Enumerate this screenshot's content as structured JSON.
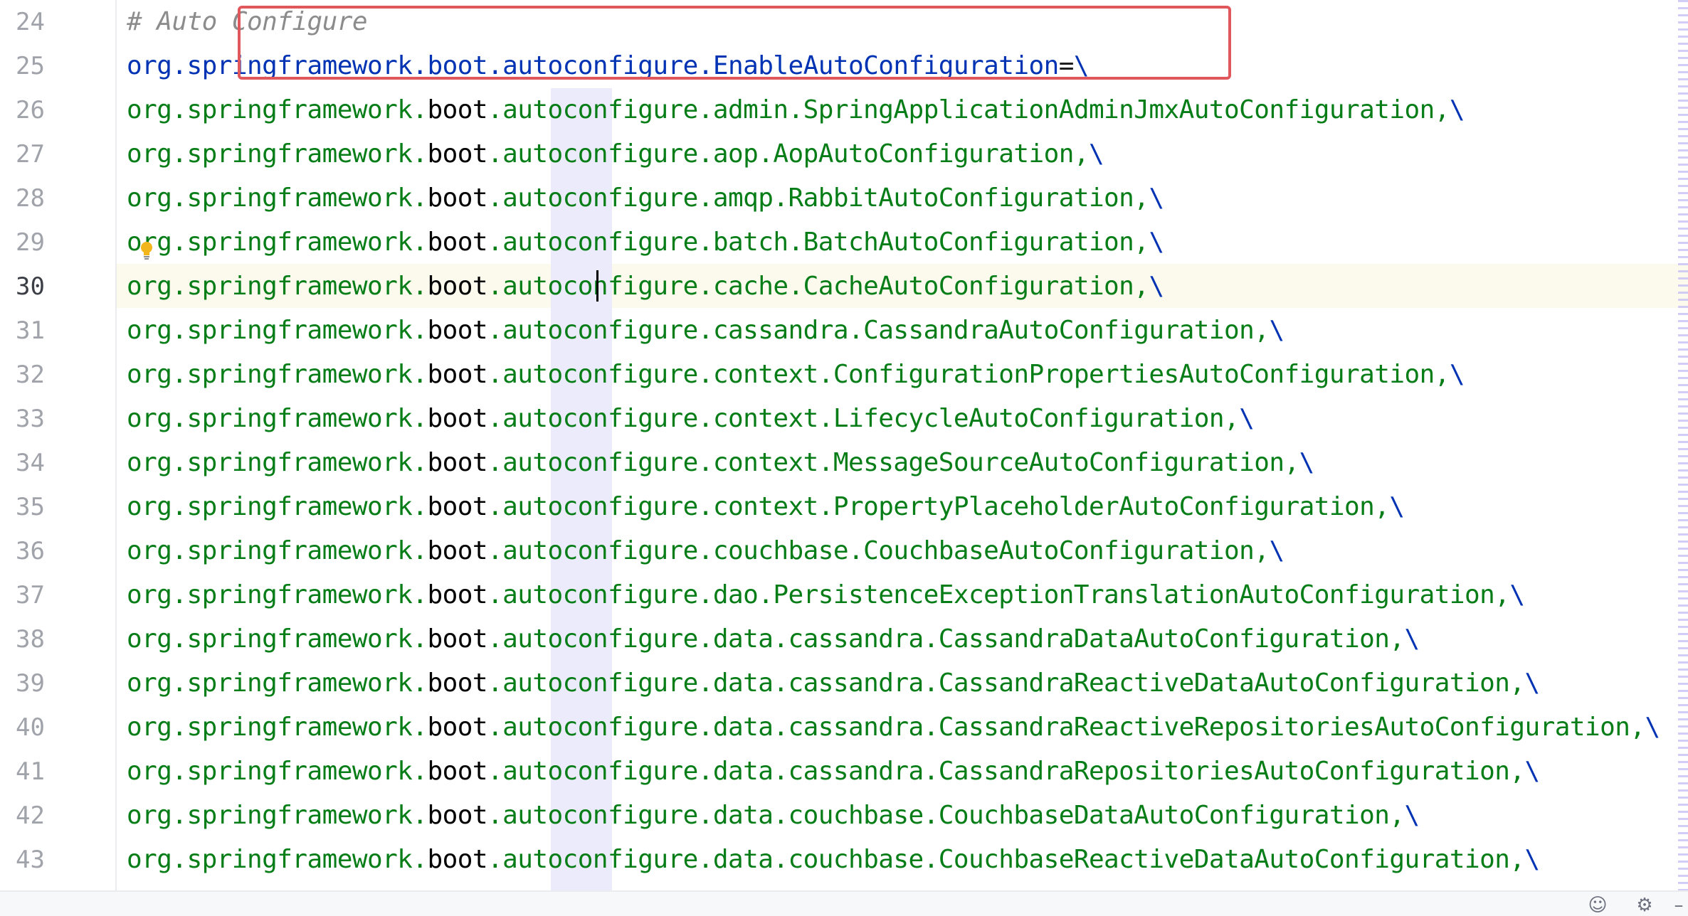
{
  "editor": {
    "current_line": 30,
    "lines": [
      {
        "num": "24",
        "kind": "comment",
        "text": "# Auto Configure"
      },
      {
        "num": "25",
        "kind": "key",
        "pkg": "org.springframework.",
        "boot": "boot",
        "rest": ".autoconfigure.EnableAutoConfiguration",
        "op": "=",
        "cont": "\\"
      },
      {
        "num": "26",
        "kind": "value",
        "pkg": "org.springframework.",
        "boot": "boot",
        "rest": ".autoconfigure.admin.SpringApplicationAdminJmxAutoConfiguration,",
        "cont": "\\"
      },
      {
        "num": "27",
        "kind": "value",
        "pkg": "org.springframework.",
        "boot": "boot",
        "rest": ".autoconfigure.aop.AopAutoConfiguration,",
        "cont": "\\"
      },
      {
        "num": "28",
        "kind": "value",
        "pkg": "org.springframework.",
        "boot": "boot",
        "rest": ".autoconfigure.amqp.RabbitAutoConfiguration,",
        "cont": "\\"
      },
      {
        "num": "29",
        "kind": "value",
        "pkg": "org.springframework.",
        "boot": "boot",
        "rest": ".autoconfigure.batch.BatchAutoConfiguration,",
        "cont": "\\"
      },
      {
        "num": "30",
        "kind": "value",
        "pkg": "org.springframework.",
        "boot": "boot",
        "rest": ".autoconfigure.cache.CacheAutoConfiguration,",
        "cont": "\\"
      },
      {
        "num": "31",
        "kind": "value",
        "pkg": "org.springframework.",
        "boot": "boot",
        "rest": ".autoconfigure.cassandra.CassandraAutoConfiguration,",
        "cont": "\\"
      },
      {
        "num": "32",
        "kind": "value",
        "pkg": "org.springframework.",
        "boot": "boot",
        "rest": ".autoconfigure.context.ConfigurationPropertiesAutoConfiguration,",
        "cont": "\\"
      },
      {
        "num": "33",
        "kind": "value",
        "pkg": "org.springframework.",
        "boot": "boot",
        "rest": ".autoconfigure.context.LifecycleAutoConfiguration,",
        "cont": "\\"
      },
      {
        "num": "34",
        "kind": "value",
        "pkg": "org.springframework.",
        "boot": "boot",
        "rest": ".autoconfigure.context.MessageSourceAutoConfiguration,",
        "cont": "\\"
      },
      {
        "num": "35",
        "kind": "value",
        "pkg": "org.springframework.",
        "boot": "boot",
        "rest": ".autoconfigure.context.PropertyPlaceholderAutoConfiguration,",
        "cont": "\\"
      },
      {
        "num": "36",
        "kind": "value",
        "pkg": "org.springframework.",
        "boot": "boot",
        "rest": ".autoconfigure.couchbase.CouchbaseAutoConfiguration,",
        "cont": "\\"
      },
      {
        "num": "37",
        "kind": "value",
        "pkg": "org.springframework.",
        "boot": "boot",
        "rest": ".autoconfigure.dao.PersistenceExceptionTranslationAutoConfiguration,",
        "cont": "\\"
      },
      {
        "num": "38",
        "kind": "value",
        "pkg": "org.springframework.",
        "boot": "boot",
        "rest": ".autoconfigure.data.cassandra.CassandraDataAutoConfiguration,",
        "cont": "\\"
      },
      {
        "num": "39",
        "kind": "value",
        "pkg": "org.springframework.",
        "boot": "boot",
        "rest": ".autoconfigure.data.cassandra.CassandraReactiveDataAutoConfiguration,",
        "cont": "\\"
      },
      {
        "num": "40",
        "kind": "value",
        "pkg": "org.springframework.",
        "boot": "boot",
        "rest": ".autoconfigure.data.cassandra.CassandraReactiveRepositoriesAutoConfiguration,",
        "cont": "\\"
      },
      {
        "num": "41",
        "kind": "value",
        "pkg": "org.springframework.",
        "boot": "boot",
        "rest": ".autoconfigure.data.cassandra.CassandraRepositoriesAutoConfiguration,",
        "cont": "\\"
      },
      {
        "num": "42",
        "kind": "value",
        "pkg": "org.springframework.",
        "boot": "boot",
        "rest": ".autoconfigure.data.couchbase.CouchbaseDataAutoConfiguration,",
        "cont": "\\"
      },
      {
        "num": "43",
        "kind": "value",
        "pkg": "org.springframework.",
        "boot": "boot",
        "rest": ".autoconfigure.data.couchbase.CouchbaseReactiveDataAutoConfiguration,",
        "cont": "\\"
      }
    ]
  },
  "status_icons": [
    {
      "name": "smiley-icon",
      "glyph": "☺"
    },
    {
      "name": "gear-icon",
      "glyph": "⚙"
    },
    {
      "name": "minimize-icon",
      "glyph": "–"
    }
  ],
  "colors": {
    "package": "#067d17",
    "key": "#0033b3",
    "comment": "#8c8c8c",
    "selection_border": "#e0575c",
    "current_line": "#fcfaed",
    "identifier_highlight": "#ecebfb"
  }
}
